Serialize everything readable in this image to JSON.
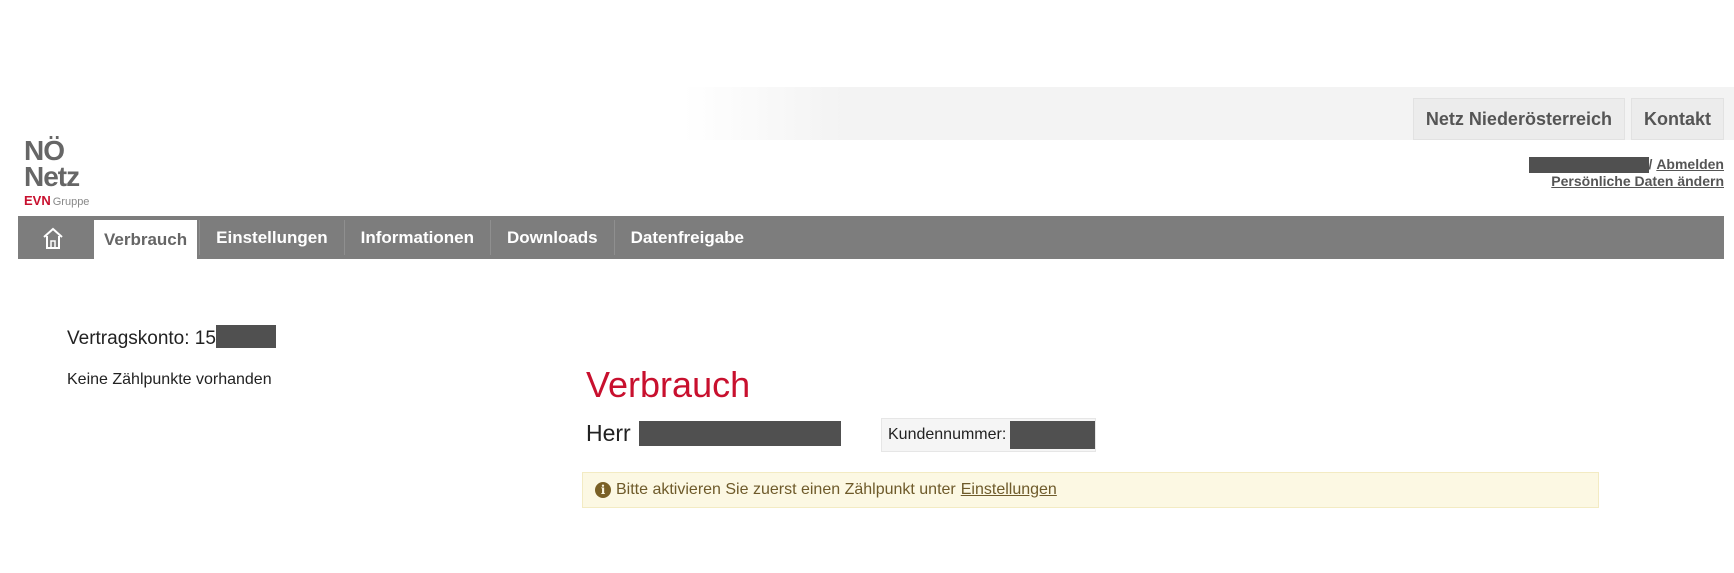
{
  "top_links": [
    "Netz Niederösterreich",
    "Kontakt"
  ],
  "logo": {
    "line1": "NÖ",
    "line2": "Netz",
    "brand": "EVN",
    "brand_suffix": "Gruppe"
  },
  "user": {
    "separator": "/",
    "logout": "Abmelden",
    "edit_profile": "Persönliche Daten ändern"
  },
  "nav": {
    "home_icon": "home-icon",
    "items": [
      "Verbrauch",
      "Einstellungen",
      "Informationen",
      "Downloads",
      "Datenfreigabe"
    ],
    "active": "Verbrauch"
  },
  "left": {
    "contract_label": "Vertragskonto: 15",
    "no_meter_points": "Keine Zählpunkte vorhanden"
  },
  "main": {
    "title": "Verbrauch",
    "salutation": "Herr",
    "customer_number_label": "Kundennummer:"
  },
  "alert": {
    "icon": "info-icon",
    "text": "Bitte aktivieren Sie zuerst einen Zählpunkt unter",
    "link": "Einstellungen"
  },
  "colors": {
    "brand_red": "#c8102e",
    "nav_grey": "#7d7d7d",
    "alert_bg": "#fcf8e3"
  }
}
